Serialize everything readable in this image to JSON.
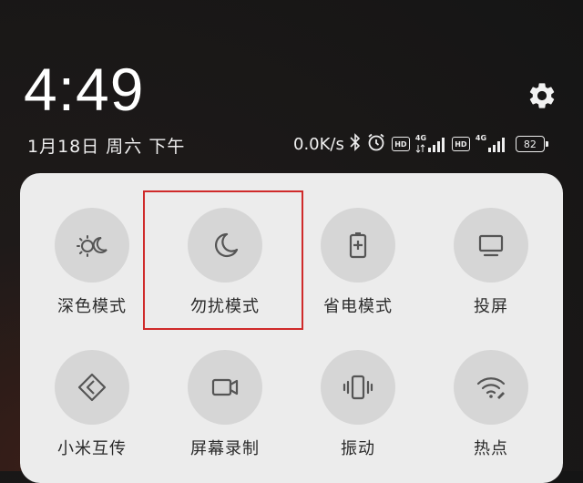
{
  "status": {
    "time": "4:49",
    "date": "1月18日 周六 下午",
    "net_speed": "0.0K/s",
    "hd_label": "HD",
    "net_type_1": "4G",
    "net_type_2": "4G",
    "battery": "82"
  },
  "icons": {
    "settings": "gear-icon",
    "bluetooth": "bluetooth-icon",
    "alarm": "alarm-clock-icon"
  },
  "tiles": [
    {
      "label": "深色模式",
      "icon": "dark-mode-icon"
    },
    {
      "label": "勿扰模式",
      "icon": "moon-icon"
    },
    {
      "label": "省电模式",
      "icon": "battery-saver-icon"
    },
    {
      "label": "投屏",
      "icon": "cast-screen-icon"
    },
    {
      "label": "小米互传",
      "icon": "share-transfer-icon"
    },
    {
      "label": "屏幕录制",
      "icon": "video-camera-icon"
    },
    {
      "label": "振动",
      "icon": "vibrate-icon"
    },
    {
      "label": "热点",
      "icon": "hotspot-icon"
    }
  ],
  "colors": {
    "panel_bg": "#ececec",
    "tile_circle": "#d6d6d6",
    "icon_color": "#555555",
    "highlight_border": "#cf2a2a"
  }
}
